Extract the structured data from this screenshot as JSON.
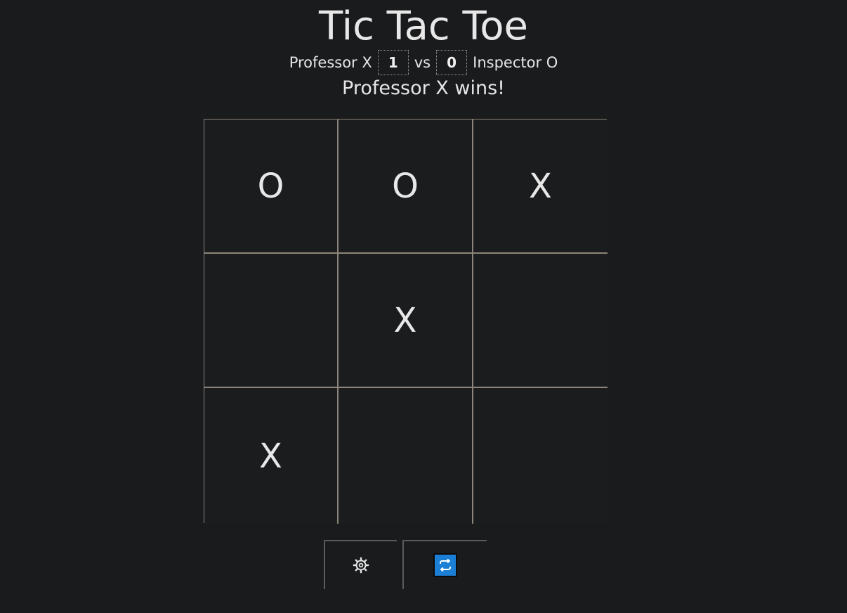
{
  "header": {
    "title": "Tic Tac Toe"
  },
  "scoreboard": {
    "player_x_name": "Professor X",
    "player_x_score": "1",
    "vs_label": "vs",
    "player_o_score": "0",
    "player_o_name": "Inspector O"
  },
  "status": {
    "message": "Professor X wins!"
  },
  "board": {
    "cells": [
      "O",
      "O",
      "X",
      "",
      "X",
      "",
      "X",
      "",
      ""
    ]
  },
  "toolbar": {
    "settings_icon": "gear-icon",
    "reset_icon": "repeat-icon",
    "reset_icon_color": "#1b7fd6"
  },
  "colors": {
    "background": "#1a1b1d",
    "grid_lines": "#8b847a",
    "text": "#e6e6e6"
  }
}
